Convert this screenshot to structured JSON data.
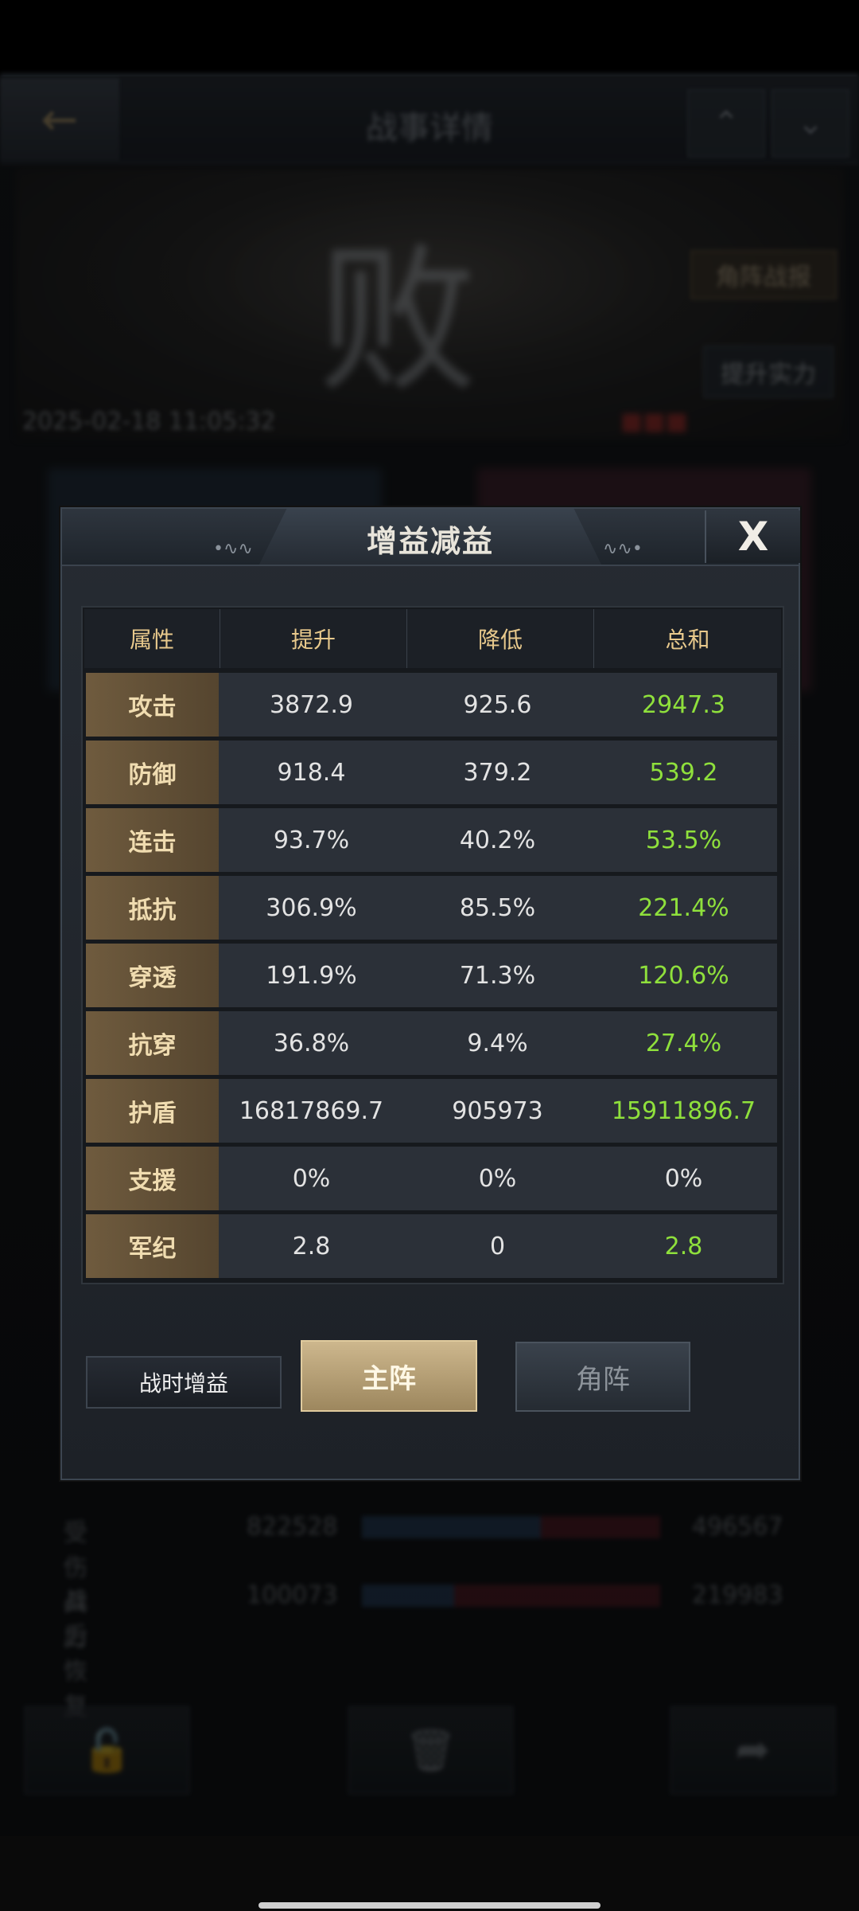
{
  "background": {
    "title": "战事详情",
    "banner_button_top": "角阵战报",
    "banner_button_bottom": "提升实力",
    "date": "2025-02-18 11:05:32",
    "stats": [
      {
        "label": "受伤兵力",
        "left": "822528",
        "right": "496567",
        "ratio": 0.6
      },
      {
        "label": "战后恢复",
        "left": "100073",
        "right": "219983",
        "ratio": 0.31
      }
    ]
  },
  "modal": {
    "title": "增益减益",
    "close_label": "X",
    "table": {
      "headers": [
        "属性",
        "提升",
        "降低",
        "总和"
      ],
      "rows": [
        {
          "name": "攻击",
          "up": "3872.9",
          "down": "925.6",
          "total": "2947.3"
        },
        {
          "name": "防御",
          "up": "918.4",
          "down": "379.2",
          "total": "539.2"
        },
        {
          "name": "连击",
          "up": "93.7%",
          "down": "40.2%",
          "total": "53.5%"
        },
        {
          "name": "抵抗",
          "up": "306.9%",
          "down": "85.5%",
          "total": "221.4%"
        },
        {
          "name": "穿透",
          "up": "191.9%",
          "down": "71.3%",
          "total": "120.6%"
        },
        {
          "name": "抗穿",
          "up": "36.8%",
          "down": "9.4%",
          "total": "27.4%"
        },
        {
          "name": "护盾",
          "up": "16817869.7",
          "down": "905973",
          "total": "15911896.7"
        },
        {
          "name": "支援",
          "up": "0%",
          "down": "0%",
          "total": "0%"
        },
        {
          "name": "军纪",
          "up": "2.8",
          "down": "0",
          "total": "2.8"
        }
      ],
      "total_colors": [
        "#8fe03c",
        "#8fe03c",
        "#8fe03c",
        "#8fe03c",
        "#8fe03c",
        "#8fe03c",
        "#8fe03c",
        "#e3e3e3",
        "#8fe03c"
      ]
    },
    "tabs": {
      "wartime": "战时增益",
      "main": "主阵",
      "side": "角阵"
    }
  }
}
